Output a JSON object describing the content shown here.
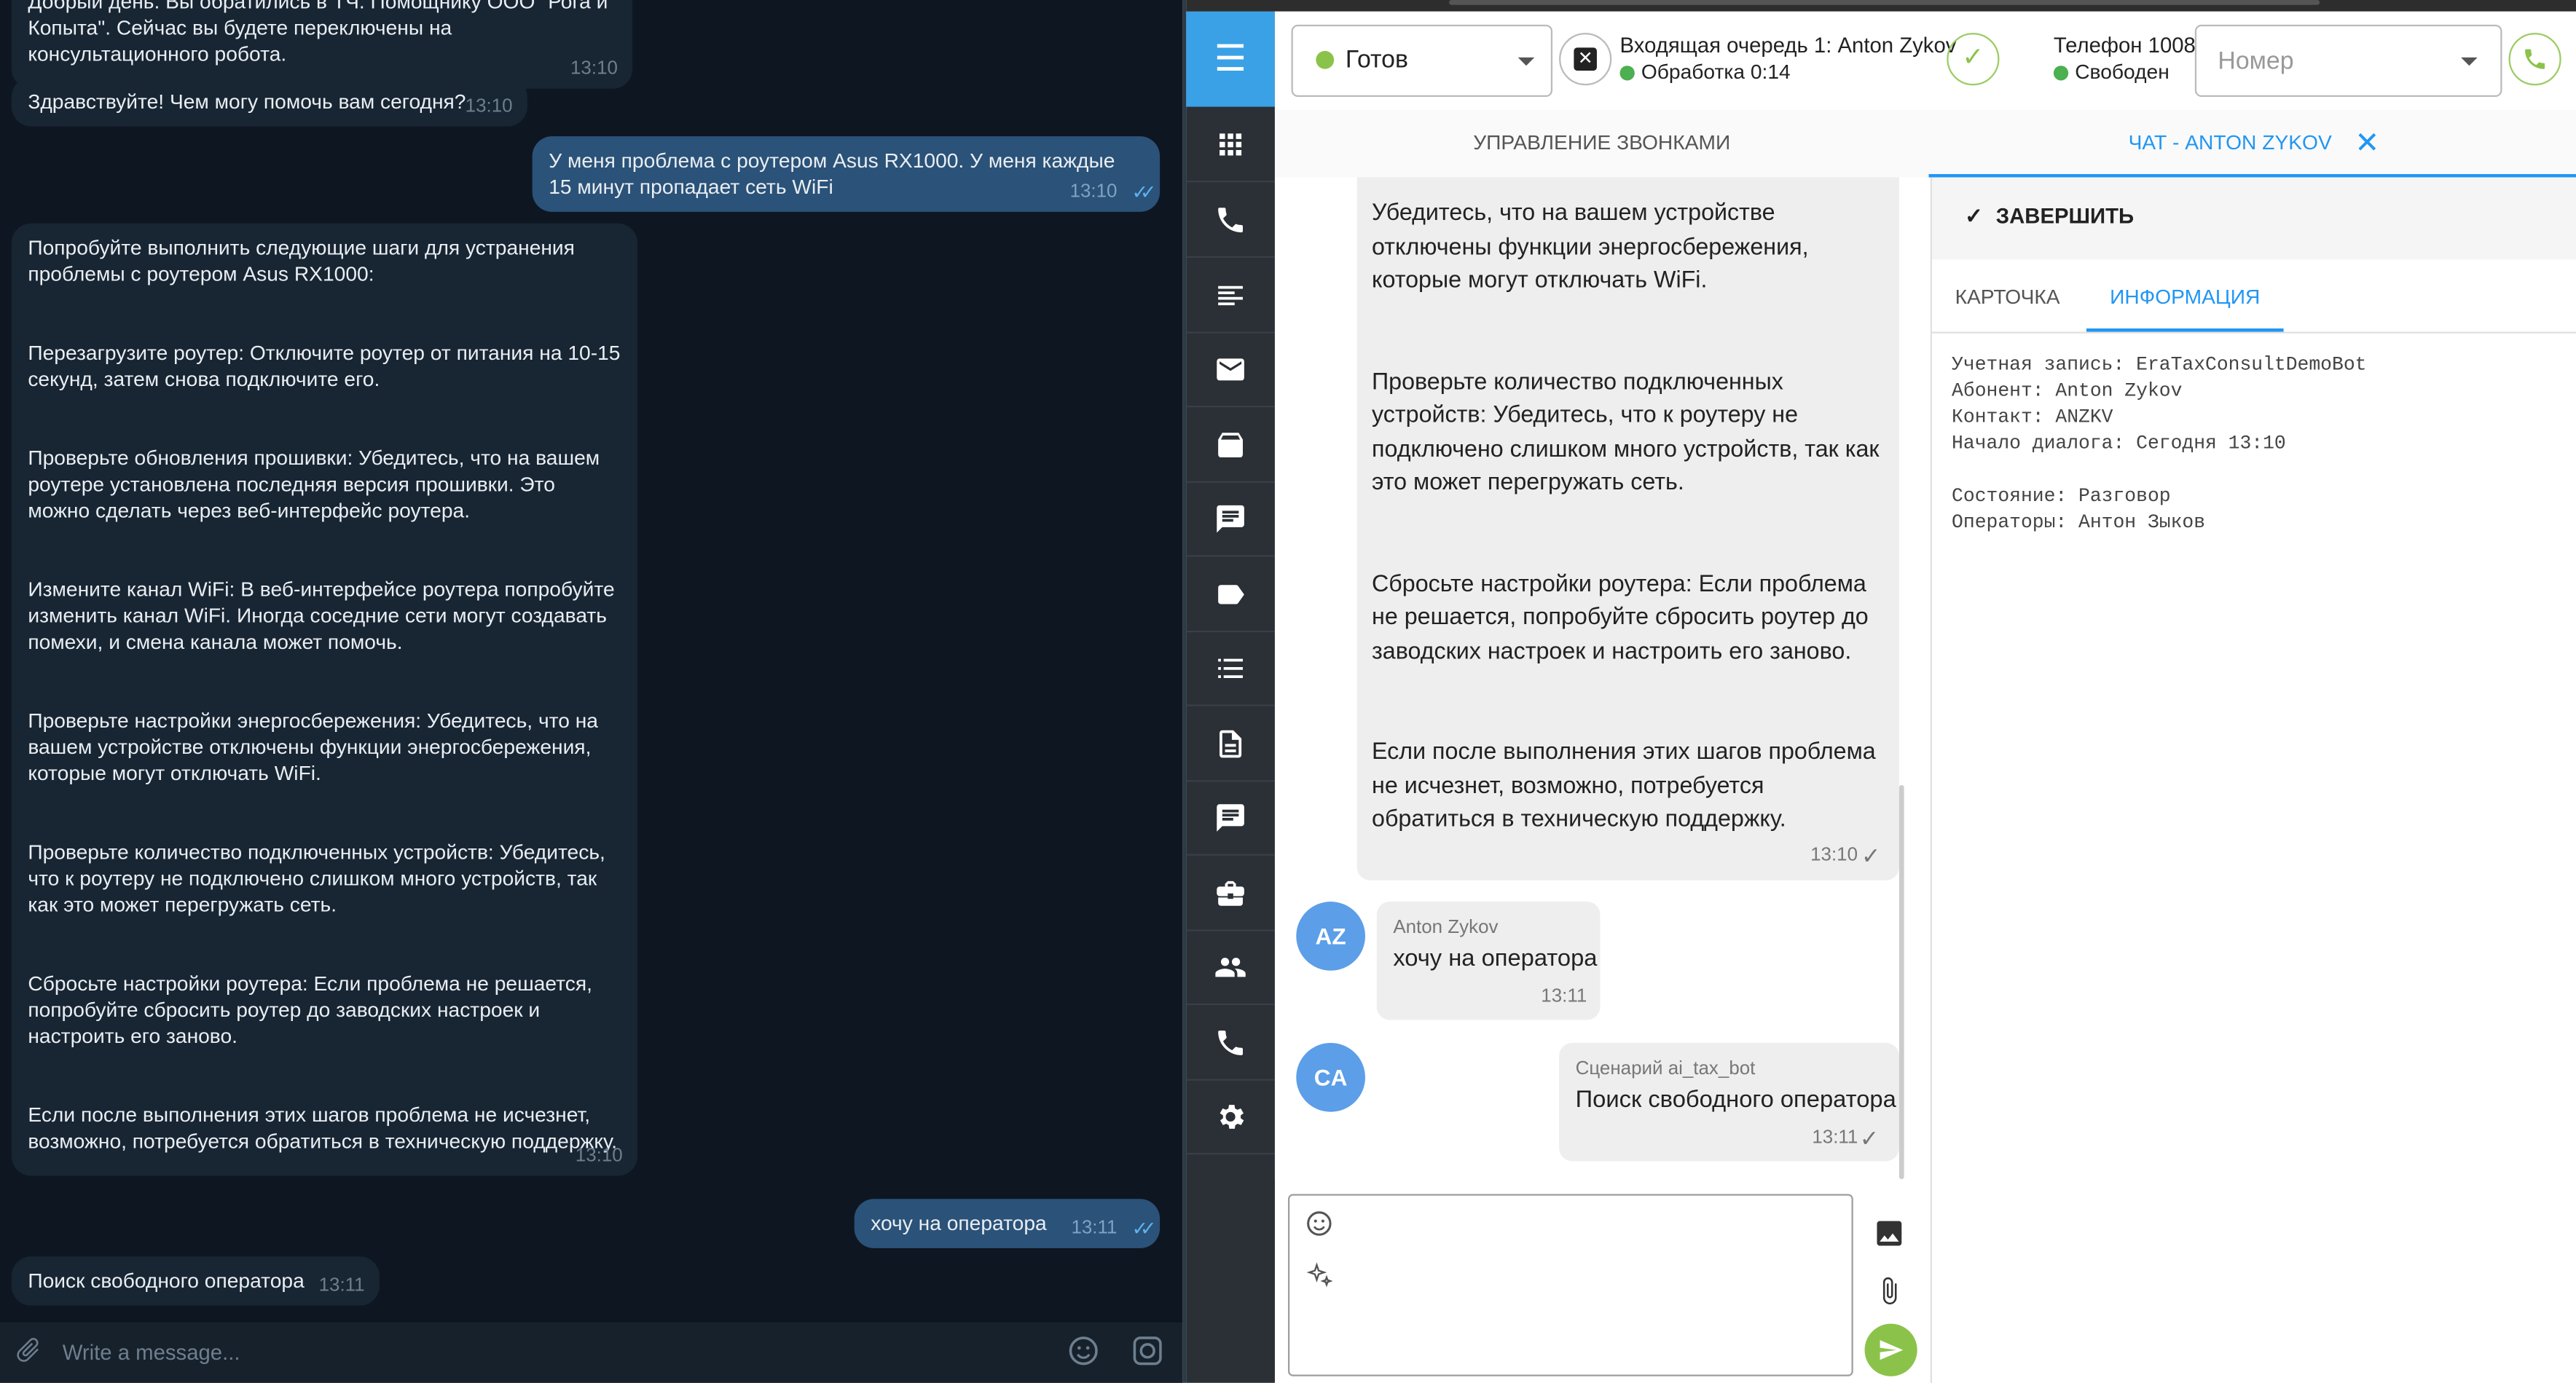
{
  "telegram": {
    "top_partial": "Добрый день. Вы обратились в ТЧ. Помощнику ООО \"Рога и Копыта\". Сейчас вы будете переключены на консультационного робота.",
    "top_partial_time": "13:10",
    "greeting": "Здравствуйте! Чем могу помочь вам сегодня?",
    "greeting_time": "13:10",
    "user_problem": "У меня проблема с роутером Asus RX1000. У меня каждые 15 минут пропадает сеть WiFi",
    "user_problem_time": "13:10",
    "bot_answer": [
      "Попробуйте выполнить следующие шаги для устранения проблемы с роутером Asus RX1000:",
      "Перезагрузите роутер: Отключите роутер от питания на 10-15 секунд, затем снова подключите его.",
      "Проверьте обновления прошивки: Убедитесь, что на вашем роутере установлена последняя версия прошивки. Это можно сделать через веб-интерфейс роутера.",
      "Измените канал WiFi: В веб-интерфейсе роутера попробуйте изменить канал WiFi. Иногда соседние сети могут создавать помехи, и смена канала может помочь.",
      "Проверьте настройки энергосбережения: Убедитесь, что на вашем устройстве отключены функции энергосбережения, которые могут отключать WiFi.",
      "Проверьте количество подключенных устройств: Убедитесь, что к роутеру не подключено слишком много устройств, так как это может перегружать сеть.",
      "Сбросьте настройки роутера: Если проблема не решается, попробуйте сбросить роутер до заводских настроек и настроить его заново.",
      "Если после выполнения этих шагов проблема не исчезнет, возможно, потребуется обратиться в техническую поддержку."
    ],
    "bot_answer_time": "13:10",
    "user_operator": "хочу на оператора",
    "user_operator_time": "13:11",
    "search_operator": "Поиск свободного оператора",
    "search_operator_time": "13:11",
    "input_placeholder": "Write a message..."
  },
  "crm": {
    "status": "Готов",
    "queue_title": "Входящая очередь 1: Anton Zykov",
    "queue_processing": "Обработка 0:14",
    "phone_title": "Телефон 1008",
    "phone_state": "Свободен",
    "number_placeholder": "Номер",
    "tab_calls": "УПРАВЛЕНИЕ ЗВОНКАМИ",
    "tab_chat": "ЧАТ - ANTON ZYKOV",
    "chat": {
      "bot_paragraphs": [
        "Убедитесь, что на вашем устройстве отключены функции энергосбережения, которые могут отключать WiFi.",
        "Проверьте количество подключенных устройств: Убедитесь, что к роутеру не подключено слишком много устройств, так как это может перегружать сеть.",
        "Сбросьте настройки роутера: Если проблема не решается, попробуйте сбросить роутер до заводских настроек и настроить его заново.",
        "Если после выполнения этих шагов проблема не исчезнет, возможно, потребуется обратиться в техническую поддержку."
      ],
      "bot_time": "13:10",
      "client_initials": "AZ",
      "client_name": "Anton Zykov",
      "client_message": "хочу на оператора",
      "client_time": "13:11",
      "scenario_initials": "CA",
      "scenario_name": "Сценарий ai_tax_bot",
      "scenario_message": "Поиск свободного оператора",
      "scenario_time": "13:11"
    },
    "finish_label": "ЗАВЕРШИТЬ",
    "info_tab_card": "КАРТОЧКА",
    "info_tab_info": "ИНФОРМАЦИЯ",
    "info_text": "Учетная запись: EraTaxConsultDemoBot\nАбонент: Anton Zykov\nКонтакт: ANZKV\nНачало диалога: Сегодня 13:10\n\nСостояние: Разговор\nОператоры: Антон Зыков",
    "colors": {
      "accent": "#2196f3",
      "sidebar": "#2b2f36",
      "menu": "#3ba1e6",
      "ok": "#8bc34a"
    }
  }
}
